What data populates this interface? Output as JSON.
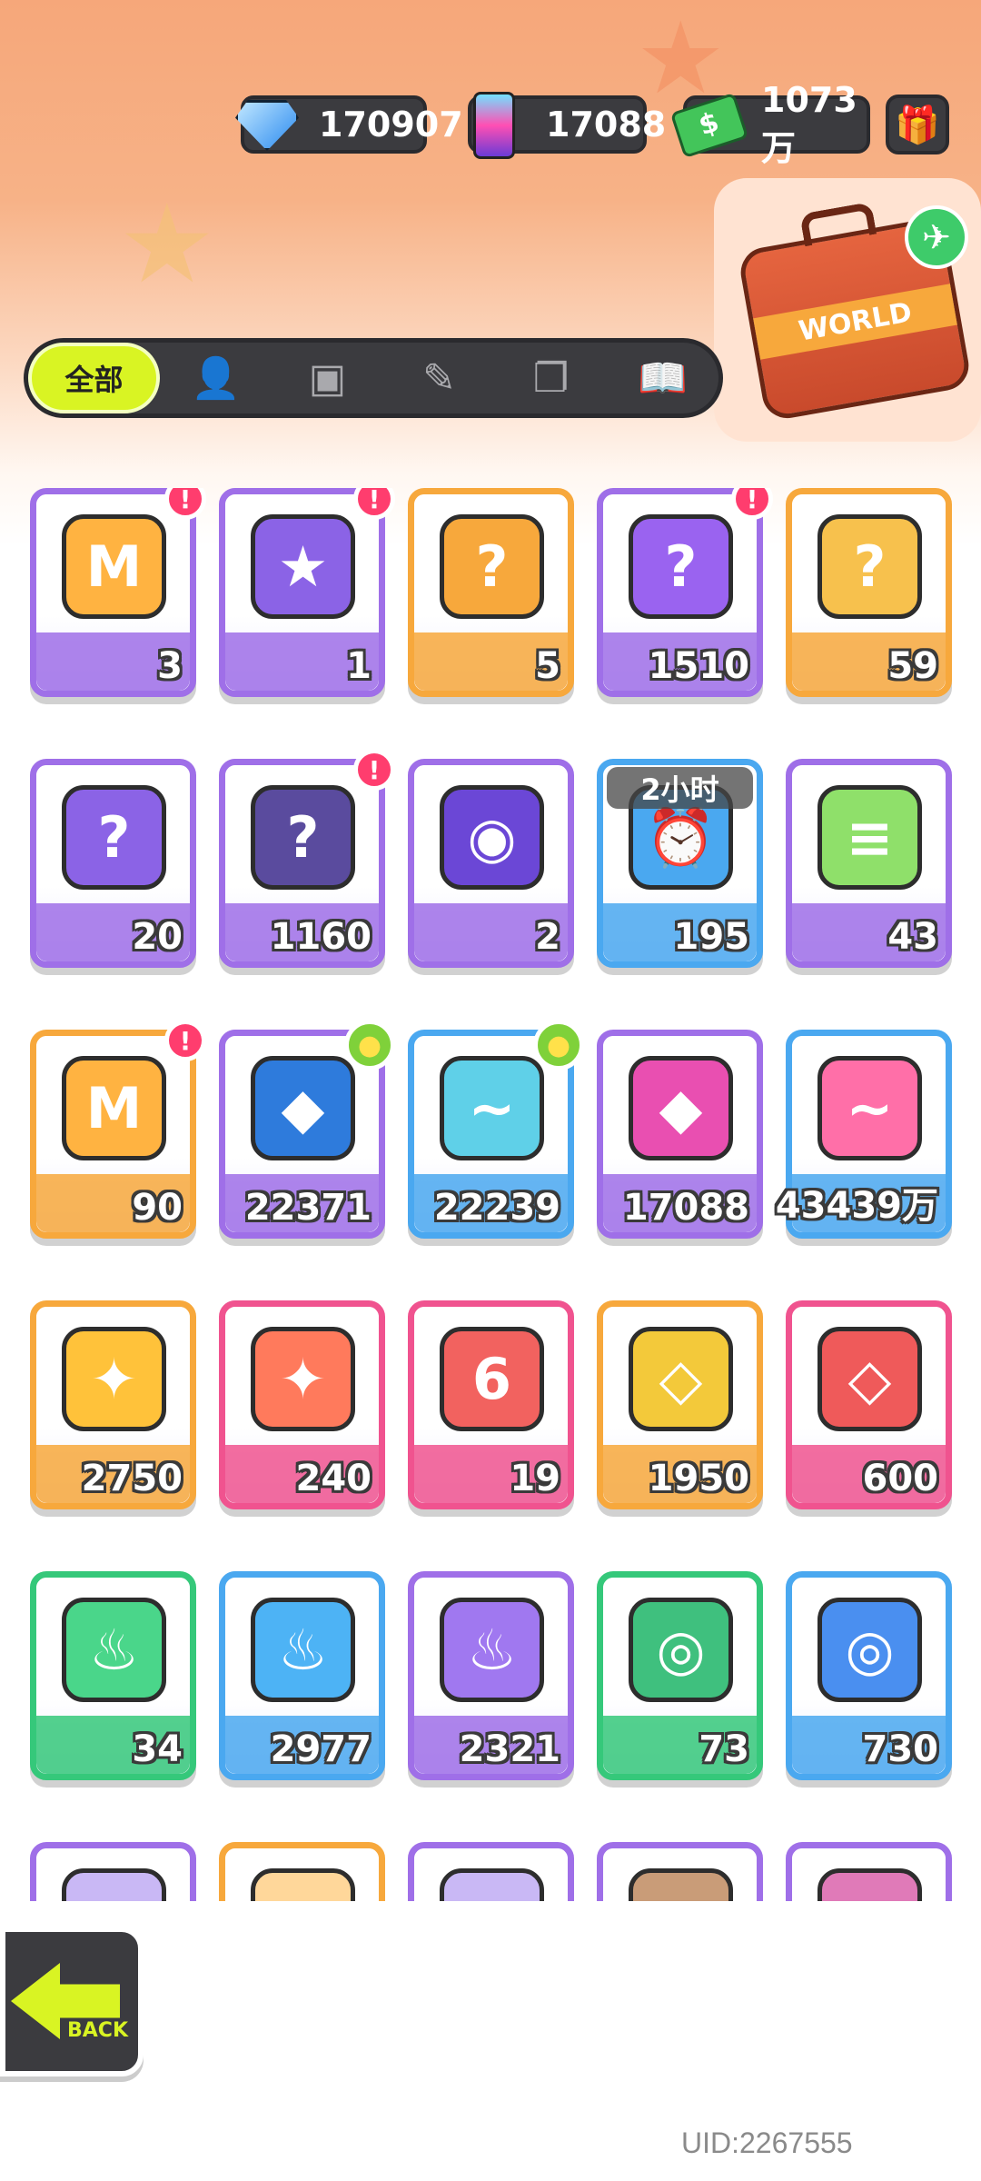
{
  "currencies": [
    {
      "name": "gems",
      "value": "170907",
      "icon": "diamond-icon"
    },
    {
      "name": "spray",
      "value": "17088",
      "icon": "spray-can-icon"
    },
    {
      "name": "cash",
      "value": "1073万",
      "icon": "cash-icon"
    }
  ],
  "suitcase": {
    "label": "WORLD"
  },
  "tabs": [
    {
      "label": "全部",
      "icon": "all-tab",
      "active": true
    },
    {
      "label": "",
      "icon": "person-icon"
    },
    {
      "label": "",
      "icon": "box-icon"
    },
    {
      "label": "",
      "icon": "spray-icon"
    },
    {
      "label": "",
      "icon": "card-icon"
    },
    {
      "label": "",
      "icon": "book-icon"
    }
  ],
  "items": [
    {
      "name": "cool-box-orange",
      "count": "3",
      "border": "#9f6fe8",
      "fill": "#ffb341",
      "glyph": "M",
      "badge": "new"
    },
    {
      "name": "travel-card-purple",
      "count": "1",
      "border": "#9f6fe8",
      "fill": "#8b63e6",
      "glyph": "★",
      "badge": "new"
    },
    {
      "name": "mystery-egg-orange",
      "count": "5",
      "border": "#f7a83c",
      "fill": "#f7a83c",
      "glyph": "?",
      "badge": ""
    },
    {
      "name": "mystery-egg-purple",
      "count": "1510",
      "border": "#9f6fe8",
      "fill": "#9a63f0",
      "glyph": "?",
      "badge": "new"
    },
    {
      "name": "deity-badge-orange",
      "count": "59",
      "border": "#f7a83c",
      "fill": "#f7c14d",
      "glyph": "?",
      "badge": ""
    },
    {
      "name": "deity-badge-purple",
      "count": "20",
      "border": "#9f6fe8",
      "fill": "#8b63e6",
      "glyph": "?",
      "badge": ""
    },
    {
      "name": "travel-card-dark",
      "count": "1160",
      "border": "#9f6fe8",
      "fill": "#5a4b9e",
      "glyph": "?",
      "badge": "new"
    },
    {
      "name": "piranha-token",
      "count": "2",
      "border": "#9f6fe8",
      "fill": "#6b47d6",
      "glyph": "◉",
      "badge": ""
    },
    {
      "name": "alarm-clock",
      "count": "195",
      "border": "#4aa8f0",
      "fill": "#4aa8f0",
      "glyph": "⏰",
      "badge": "",
      "timer": "2小时"
    },
    {
      "name": "green-cup",
      "count": "43",
      "border": "#9f6fe8",
      "fill": "#8fe06a",
      "glyph": "≡",
      "badge": ""
    },
    {
      "name": "cool-box-fish",
      "count": "90",
      "border": "#f7a83c",
      "fill": "#ffb341",
      "glyph": "M",
      "badge": "new"
    },
    {
      "name": "spray-blue",
      "count": "22371",
      "border": "#9f6fe8",
      "fill": "#2e7bdc",
      "glyph": "◆",
      "badge": "chick"
    },
    {
      "name": "paint-tube-rainbow",
      "count": "22239",
      "border": "#4aa8f0",
      "fill": "#5fd0e8",
      "glyph": "~",
      "badge": "chick"
    },
    {
      "name": "spray-pink",
      "count": "17088",
      "border": "#9f6fe8",
      "fill": "#e94fb1",
      "glyph": "◆",
      "badge": ""
    },
    {
      "name": "paint-tube-pink",
      "count": "43439万",
      "border": "#4aa8f0",
      "fill": "#ff6fa8",
      "glyph": "~",
      "badge": ""
    },
    {
      "name": "star-crystal-yellow",
      "count": "2750",
      "border": "#f7a83c",
      "fill": "#ffc23a",
      "glyph": "✦",
      "badge": ""
    },
    {
      "name": "star-crystal-red",
      "count": "240",
      "border": "#f0538f",
      "fill": "#ff7a5c",
      "glyph": "✦",
      "badge": ""
    },
    {
      "name": "dice-block-red",
      "count": "19",
      "border": "#f0538f",
      "fill": "#f2625f",
      "glyph": "6",
      "badge": ""
    },
    {
      "name": "gem-yellow",
      "count": "1950",
      "border": "#f7a83c",
      "fill": "#f3c93a",
      "glyph": "◇",
      "badge": ""
    },
    {
      "name": "gem-red",
      "count": "600",
      "border": "#f0538f",
      "fill": "#ef5a5a",
      "glyph": "◇",
      "badge": ""
    },
    {
      "name": "flame-green",
      "count": "34",
      "border": "#35c87a",
      "fill": "#4ad68a",
      "glyph": "♨",
      "badge": ""
    },
    {
      "name": "flame-blue",
      "count": "2977",
      "border": "#4aa8f0",
      "fill": "#4db3f5",
      "glyph": "♨",
      "badge": ""
    },
    {
      "name": "flame-purple",
      "count": "2321",
      "border": "#9f6fe8",
      "fill": "#a078f0",
      "glyph": "♨",
      "badge": ""
    },
    {
      "name": "film-roll-green",
      "count": "73",
      "border": "#35c87a",
      "fill": "#3fc07e",
      "glyph": "◎",
      "badge": ""
    },
    {
      "name": "film-roll-blue",
      "count": "730",
      "border": "#4aa8f0",
      "fill": "#4a8ff0",
      "glyph": "◎",
      "badge": ""
    },
    {
      "name": "partial-item-1",
      "count": "",
      "border": "#9f6fe8",
      "fill": "#c9b8f5",
      "glyph": "",
      "badge": ""
    },
    {
      "name": "partial-item-2",
      "count": "",
      "border": "#f7a83c",
      "fill": "#ffd79a",
      "glyph": "",
      "badge": ""
    },
    {
      "name": "partial-item-3",
      "count": "",
      "border": "#9f6fe8",
      "fill": "#c9b8f5",
      "glyph": "",
      "badge": ""
    },
    {
      "name": "partial-item-4",
      "count": "",
      "border": "#9f6fe8",
      "fill": "#c99c78",
      "glyph": "",
      "badge": ""
    },
    {
      "name": "partial-item-5",
      "count": "",
      "border": "#9f6fe8",
      "fill": "#e07ab8",
      "glyph": "",
      "badge": ""
    }
  ],
  "back": {
    "label": "BACK"
  },
  "uid": "UID:2267555"
}
